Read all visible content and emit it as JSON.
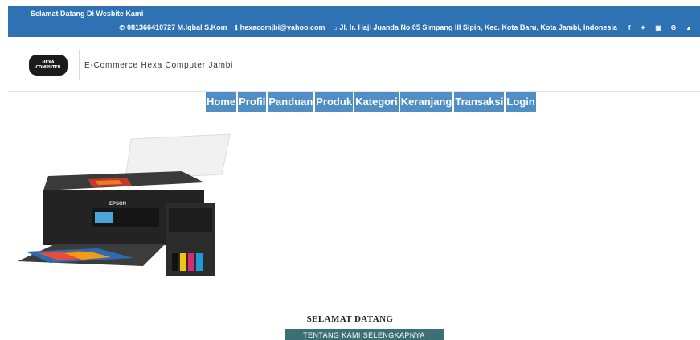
{
  "topbar": {
    "welcome": "Selamat Datang Di Wesbite Kami",
    "phone": "081366410727 M.Iqbal S.Kom",
    "email": "hexacomjbi@yahoo.com",
    "address": "Jl. Ir. Haji Juanda No.05 Simpang III Sipin, Kec. Kota Baru, Kota Jambi, Indonesia",
    "social": [
      "facebook-icon",
      "twitter-icon",
      "instagram-icon",
      "google-icon",
      "youtube-icon"
    ]
  },
  "brand": {
    "logo_line1": "HEXA",
    "logo_line2": "COMPUTER",
    "name": "E-Commerce Hexa Computer Jambi"
  },
  "nav": {
    "home": "Home",
    "profil": "Profil",
    "panduan": "Panduan",
    "produk": "Produk",
    "kategori": "Kategori",
    "keranjang": "Keranjang",
    "transaksi": "Transaksi",
    "login": "Login"
  },
  "hero": {
    "printer_brand": "EPSON",
    "title": "SELAMAT DATANG",
    "about_button": "TENTANG KAMI SELENGKAPNYA"
  },
  "colors": {
    "topbar": "#2f72b3",
    "nav": "#4f8fc4",
    "button": "#3d7075"
  }
}
